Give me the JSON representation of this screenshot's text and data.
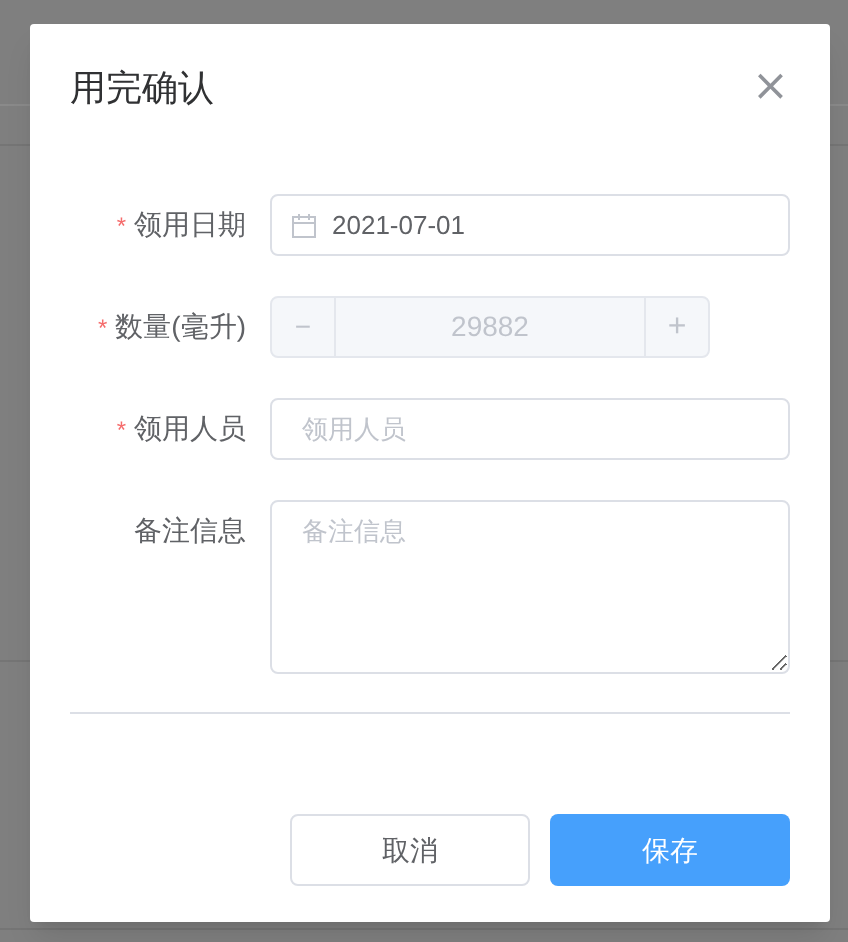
{
  "dialog": {
    "title": "用完确认",
    "close": "×"
  },
  "fields": [
    {
      "kind": "date",
      "label": "领用日期",
      "required_mark": "*",
      "value": "2021-07-01"
    },
    {
      "kind": "number",
      "label": "数量(毫升)",
      "required_mark": "*",
      "disabled": true,
      "value": "29882",
      "minus": "−",
      "plus": "+"
    },
    {
      "kind": "text",
      "label": "领用人员",
      "required_mark": "*",
      "placeholder": "领用人员"
    },
    {
      "kind": "textarea",
      "label": "备注信息",
      "placeholder": "备注信息"
    }
  ],
  "buttons": [
    {
      "label": "取消",
      "primary": false
    },
    {
      "label": "保存",
      "primary": true
    }
  ]
}
